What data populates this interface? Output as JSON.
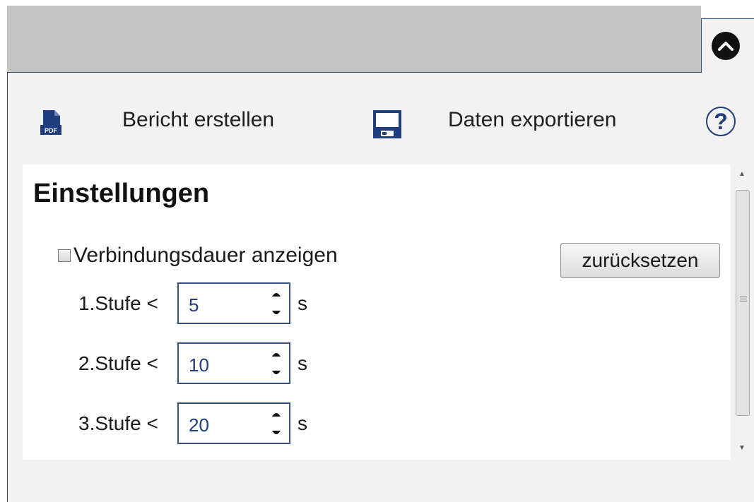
{
  "toolbar": {
    "report_label": "Bericht erstellen",
    "pdf_icon_text": "PDF",
    "export_label": "Daten exportieren",
    "help_label": "?"
  },
  "settings": {
    "title": "Einstellungen",
    "show_duration_label": "Verbindungsdauer anzeigen",
    "show_duration_checked": false,
    "reset_label": "zurücksetzen",
    "levels": [
      {
        "label": "1.Stufe <",
        "value": "5",
        "unit": "s"
      },
      {
        "label": "2.Stufe <",
        "value": "10",
        "unit": "s"
      },
      {
        "label": "3.Stufe <",
        "value": "20",
        "unit": "s"
      }
    ]
  },
  "colors": {
    "accent": "#1e3c7e",
    "panel_bg": "#f2f2f2",
    "tabbar_bg": "#c4c4c4"
  }
}
